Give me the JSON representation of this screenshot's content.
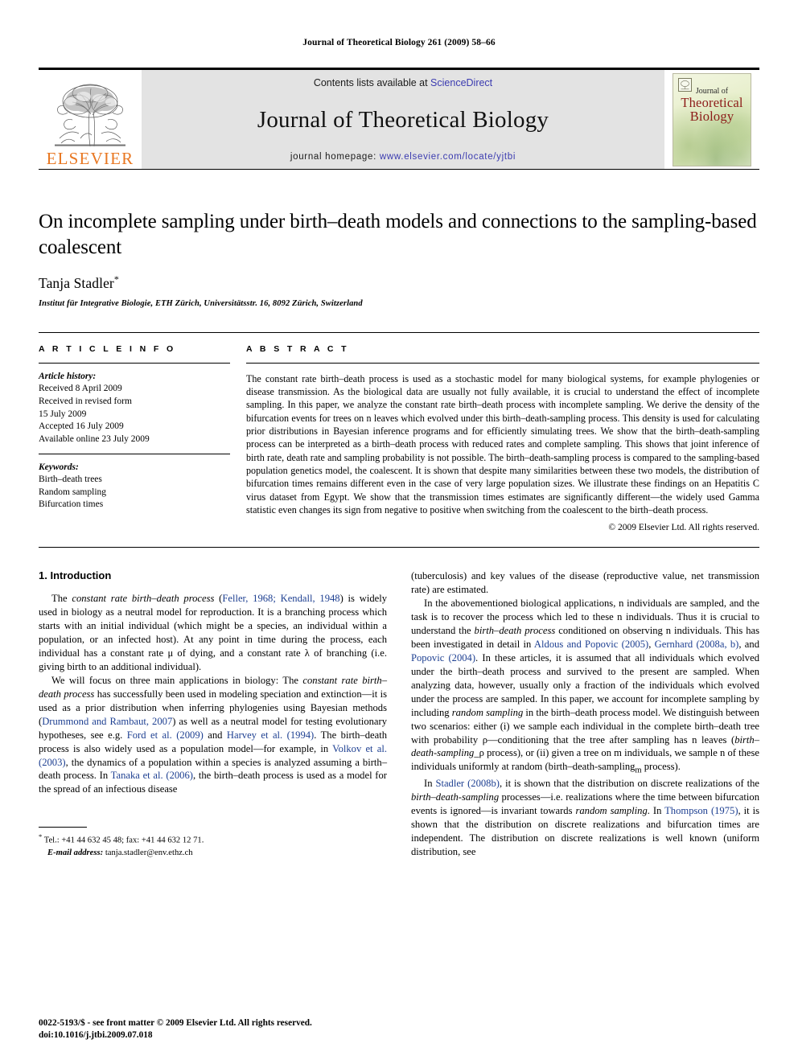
{
  "running_head": "Journal of Theoretical Biology 261 (2009) 58–66",
  "masthead": {
    "publisher_name": "ELSEVIER",
    "contents_prefix": "Contents lists available at ",
    "contents_link": "ScienceDirect",
    "journal_title": "Journal of Theoretical Biology",
    "homepage_prefix": "journal homepage: ",
    "homepage_link": "www.elsevier.com/locate/yjtbi",
    "cover": {
      "line1": "Journal of",
      "line2": "Theoretical",
      "line3": "Biology"
    },
    "colors": {
      "elsevier_orange": "#E87722",
      "link_blue": "#3b3bb0",
      "masthead_gray": "#e3e3e3",
      "cover_red": "#8c1b18"
    }
  },
  "article": {
    "title": "On incomplete sampling under birth–death models and connections to the sampling-based coalescent",
    "author": "Tanja Stadler",
    "author_marker": "*",
    "affiliation": "Institut für Integrative Biologie, ETH Zürich, Universitätsstr. 16, 8092 Zürich, Switzerland"
  },
  "article_info": {
    "heading": "A R T I C L E   I N F O",
    "history_label": "Article history:",
    "history": [
      "Received 8 April 2009",
      "Received in revised form",
      "15 July 2009",
      "Accepted 16 July 2009",
      "Available online 23 July 2009"
    ],
    "keywords_label": "Keywords:",
    "keywords": [
      "Birth–death trees",
      "Random sampling",
      "Bifurcation times"
    ]
  },
  "abstract": {
    "heading": "A B S T R A C T",
    "text": "The constant rate birth–death process is used as a stochastic model for many biological systems, for example phylogenies or disease transmission. As the biological data are usually not fully available, it is crucial to understand the effect of incomplete sampling. In this paper, we analyze the constant rate birth–death process with incomplete sampling. We derive the density of the bifurcation events for trees on n leaves which evolved under this birth–death-sampling process. This density is used for calculating prior distributions in Bayesian inference programs and for efficiently simulating trees. We show that the birth–death-sampling process can be interpreted as a birth–death process with reduced rates and complete sampling. This shows that joint inference of birth rate, death rate and sampling probability is not possible. The birth–death-sampling process is compared to the sampling-based population genetics model, the coalescent. It is shown that despite many similarities between these two models, the distribution of bifurcation times remains different even in the case of very large population sizes. We illustrate these findings on an Hepatitis C virus dataset from Egypt. We show that the transmission times estimates are significantly different—the widely used Gamma statistic even changes its sign from negative to positive when switching from the coalescent to the birth–death process.",
    "copyright": "© 2009 Elsevier Ltd. All rights reserved."
  },
  "introduction": {
    "section_title": "1.  Introduction",
    "left_paragraphs": [
      "The constant rate birth–death process (Feller, 1968; Kendall, 1948) is widely used in biology as a neutral model for reproduction. It is a branching process which starts with an initial individual (which might be a species, an individual within a population, or an infected host). At any point in time during the process, each individual has a constant rate μ of dying, and a constant rate λ of branching (i.e. giving birth to an additional individual).",
      "We will focus on three main applications in biology: The constant rate birth–death process has successfully been used in modeling speciation and extinction—it is used as a prior distribution when inferring phylogenies using Bayesian methods (Drummond and Rambaut, 2007) as well as a neutral model for testing evolutionary hypotheses, see e.g. Ford et al. (2009) and Harvey et al. (1994). The birth–death process is also widely used as a population model—for example, in Volkov et al. (2003), the dynamics of a population within a species is analyzed assuming a birth–death process. In Tanaka et al. (2006), the birth–death process is used as a model for the spread of an infectious disease"
    ],
    "right_paragraphs": [
      "(tuberculosis) and key values of the disease (reproductive value, net transmission rate) are estimated.",
      "In the abovementioned biological applications, n individuals are sampled, and the task is to recover the process which led to these n individuals. Thus it is crucial to understand the birth–death process conditioned on observing n individuals. This has been investigated in detail in Aldous and Popovic (2005), Gernhard (2008a, b), and Popovic (2004). In these articles, it is assumed that all individuals which evolved under the birth–death process and survived to the present are sampled. When analyzing data, however, usually only a fraction of the individuals which evolved under the process are sampled. In this paper, we account for incomplete sampling by including random sampling in the birth–death process model. We distinguish between two scenarios: either (i) we sample each individual in the complete birth–death tree with probability ρ—conditioning that the tree after sampling has n leaves (birth–death-sampling_ρ process), or (ii) given a tree on m individuals, we sample n of these individuals uniformly at random (birth–death-sampling_m process).",
      "In Stadler (2008b), it is shown that the distribution on discrete realizations of the birth–death-sampling processes—i.e. realizations where the time between bifurcation events is ignored—is invariant towards random sampling. In Thompson (1975), it is shown that the distribution on discrete realizations and bifurcation times are independent. The distribution on discrete realizations is well known (uniform distribution, see"
    ],
    "citation_color": "#1d3f91"
  },
  "footnote": {
    "marker": "*",
    "phone": "Tel.: +41 44 632 45 48; fax: +41 44 632 12 71.",
    "email_label": "E-mail address:",
    "email": "tanja.stadler@env.ethz.ch"
  },
  "page_footer": {
    "issn_line": "0022-5193/$ - see front matter © 2009 Elsevier Ltd. All rights reserved.",
    "doi_line": "doi:10.1016/j.jtbi.2009.07.018"
  }
}
